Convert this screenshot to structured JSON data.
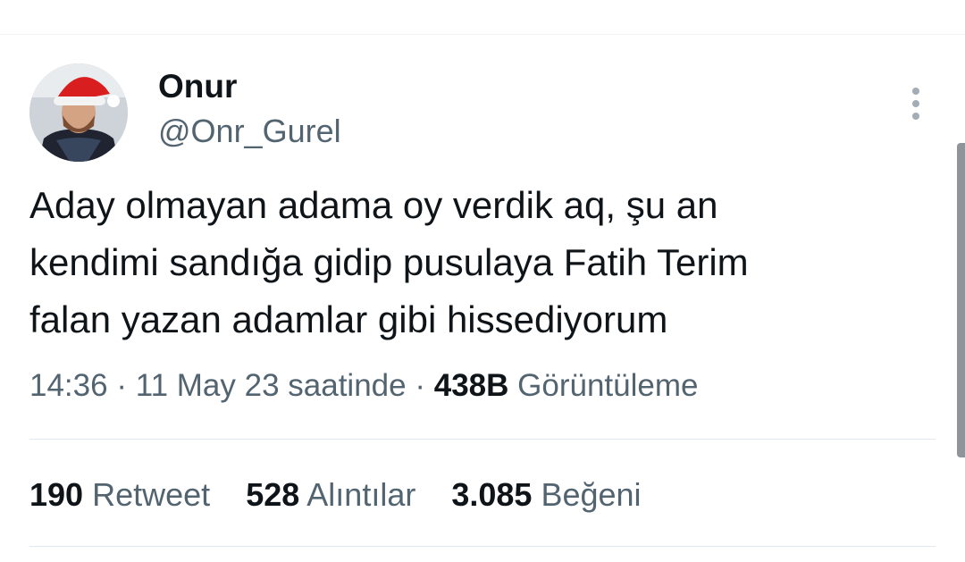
{
  "author": {
    "name": "Onur",
    "handle": "@Onr_Gurel"
  },
  "tweet": {
    "text_lines": [
      "Aday olmayan adama oy verdik aq, şu an",
      "kendimi sandığa gidip pusulaya Fatih Terim",
      "falan yazan adamlar gibi hissediyorum"
    ]
  },
  "meta": {
    "time": "14:36",
    "date": "11 May 23 saatinde",
    "views_count": "438B",
    "views_label": "Görüntüleme"
  },
  "stats": {
    "retweets": {
      "count": "190",
      "label": "Retweet"
    },
    "quotes": {
      "count": "528",
      "label": "Alıntılar"
    },
    "likes": {
      "count": "3.085",
      "label": "Beğeni"
    }
  },
  "icons": {
    "more": "more-vertical-icon"
  },
  "colors": {
    "secondary_text": "#536471",
    "primary_text": "#0f1419",
    "divider": "#e1e8ed"
  }
}
